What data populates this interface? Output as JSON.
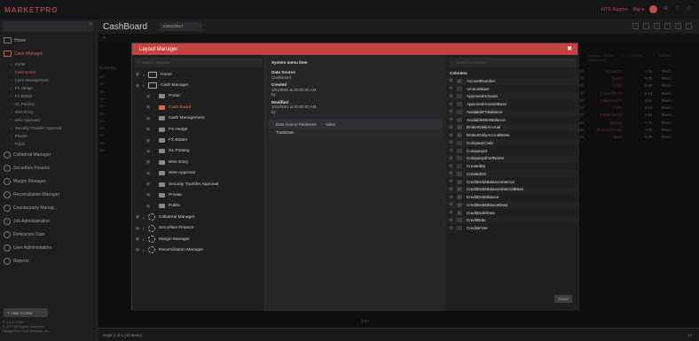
{
  "app": {
    "logo": "MARKETPRO",
    "logo_sub": "",
    "title": "CashBoard",
    "date": "04/01/2017",
    "support_link": "FITS Support",
    "user_link": "Mgr ▾"
  },
  "sidebar": {
    "items": [
      {
        "label": "Home"
      },
      {
        "label": "Cash Manager",
        "active": true
      },
      {
        "label": "Portal",
        "sub": true
      },
      {
        "label": "Cash Board",
        "sub": true,
        "active": true
      },
      {
        "label": "Cash Management",
        "sub": true
      },
      {
        "label": "FX Hedge",
        "sub": true
      },
      {
        "label": "FX Blotter",
        "sub": true
      },
      {
        "label": "GL Posting",
        "sub": true
      },
      {
        "label": "Wire Entry",
        "sub": true
      },
      {
        "label": "Wire Approval",
        "sub": true
      },
      {
        "label": "Security Transfer Approval",
        "sub": true
      },
      {
        "label": "Private",
        "sub": true
      },
      {
        "label": "Public",
        "sub": true
      },
      {
        "label": "Collateral Manager"
      },
      {
        "label": "Securities Finance"
      },
      {
        "label": "Margin Manager"
      },
      {
        "label": "Reconciliation Manager"
      },
      {
        "label": "Counterparty Manag..."
      },
      {
        "label": "Job Administration"
      },
      {
        "label": "Reference Data"
      },
      {
        "label": "User Administration"
      },
      {
        "label": "Reports"
      }
    ],
    "help": "Help Center",
    "footer": [
      "© 4.0.0.12848",
      "© 2017 All Rights Reserved",
      "HedgeFlow Fund Services, Inc."
    ]
  },
  "grid": {
    "currency_label": "Currency",
    "currency_rows": [
      "GS",
      "GS",
      "GS",
      "GS",
      "GS",
      "GS",
      "GS",
      "GS",
      "GS",
      "GS",
      "GS"
    ],
    "right_headers": [
      "T",
      "Balance - Broker (Base CCY)",
      "T",
      "FX Rate",
      "T",
      "Portfolio"
    ],
    "right_rows": [
      {
        "a": "0.00",
        "b": "52,456.72",
        "c": "1.36",
        "d": "Titanic"
      },
      {
        "a": "0.00",
        "b": "(0.00)",
        "c": "0.70",
        "d": "Titanic"
      },
      {
        "a": "0.00",
        "b": "(1.04)",
        "c": "0.00",
        "d": "Titanic"
      },
      {
        "a": "0.00",
        "b": "3,133,137.74",
        "c": "0.13",
        "d": "Titanic"
      },
      {
        "a": "0.00",
        "b": "2,666,913.77",
        "c": "0.01",
        "d": "Titanic"
      },
      {
        "a": "0.00",
        "b": "(7.90)",
        "c": "0.12",
        "d": "Titanic"
      },
      {
        "a": "0.00",
        "b": "6,665,384.28",
        "c": "0.15",
        "d": "Titanic"
      },
      {
        "a": "0.00",
        "b": "(56.62)",
        "c": "0.71",
        "d": "Titanic"
      },
      {
        "a": "0.00",
        "b": "(25,523,329.04)",
        "c": "1.00",
        "d": "Titanic"
      },
      {
        "a": "0.00",
        "b": "38.46",
        "c": "0.08",
        "d": "Titanic"
      }
    ],
    "summary": "0.00",
    "pager": "Page 1 of 1 (10 items)",
    "footer_right": "10"
  },
  "modal": {
    "title": "Layout Manager",
    "left_search_placeholder": "Search Layouts",
    "tree": [
      {
        "label": "Home",
        "level": 0,
        "icon": "home"
      },
      {
        "label": "Cash Manager",
        "level": 0,
        "icon": "home"
      },
      {
        "label": "Portal",
        "level": 1,
        "icon": "page"
      },
      {
        "label": "Cash Board",
        "level": 1,
        "icon": "page",
        "active": true
      },
      {
        "label": "Cash Management",
        "level": 1,
        "icon": "page"
      },
      {
        "label": "FX Hedge",
        "level": 1,
        "icon": "page"
      },
      {
        "label": "FX Blotter",
        "level": 1,
        "icon": "page"
      },
      {
        "label": "GL Posting",
        "level": 1,
        "icon": "page"
      },
      {
        "label": "Wire Entry",
        "level": 1,
        "icon": "page"
      },
      {
        "label": "Wire Approval",
        "level": 1,
        "icon": "page"
      },
      {
        "label": "Security Transfer Approval",
        "level": 1,
        "icon": "page"
      },
      {
        "label": "Private",
        "level": 1,
        "icon": "folder"
      },
      {
        "label": "Public",
        "level": 1,
        "icon": "folder"
      },
      {
        "label": "Collateral Manager",
        "level": 0,
        "icon": "gear"
      },
      {
        "label": "Securities Finance",
        "level": 0,
        "icon": "gear"
      },
      {
        "label": "Margin Manager",
        "level": 0,
        "icon": "gear"
      },
      {
        "label": "Reconciliation Manager",
        "level": 0,
        "icon": "gear"
      }
    ],
    "mid": {
      "title": "System menu item",
      "ds_label": "Data Source",
      "ds_value": "CashBoard",
      "created_label": "Created",
      "created_value": "1/01/0001 at 00:00:00 AM",
      "created_by": "by",
      "modified_label": "Modified",
      "modified_value": "1/01/0001 at 00:00:00 AM",
      "modified_by": "by",
      "param_col1": "Data Source Parameter",
      "param_col2": "Value",
      "param_value": "TradeDate"
    },
    "right_search_placeholder": "Search Columns",
    "columns_header": "Columns",
    "columns": [
      {
        "name": "AccountNumber",
        "checked": true
      },
      {
        "name": "AmountBase",
        "checked": false
      },
      {
        "name": "ApprovedAmount",
        "checked": false
      },
      {
        "name": "ApprovedAmountBase",
        "checked": false
      },
      {
        "name": "AvailableFXBalance",
        "checked": false
      },
      {
        "name": "AvailableWireBalance",
        "checked": false
      },
      {
        "name": "BrokerDailyAccrual",
        "checked": true
      },
      {
        "name": "BrokerDailyAccrualBase",
        "checked": true
      },
      {
        "name": "CompanyCode",
        "checked": false
      },
      {
        "name": "CompanyId",
        "checked": false
      },
      {
        "name": "CompanyShortName",
        "checked": false
      },
      {
        "name": "CreatedBy",
        "checked": false
      },
      {
        "name": "CreatedOn",
        "checked": false
      },
      {
        "name": "CreditDebitBalanceInternal",
        "checked": true
      },
      {
        "name": "CreditDebitBalanceInternalBase",
        "checked": true
      },
      {
        "name": "CreditDebitBlance",
        "checked": true
      },
      {
        "name": "CreditDebitBlanceBase",
        "checked": true
      },
      {
        "name": "CreditDebitRate",
        "checked": true
      },
      {
        "name": "CreditRate",
        "checked": false
      },
      {
        "name": "CreditsFree",
        "checked": false
      }
    ],
    "close_label": "Close"
  }
}
